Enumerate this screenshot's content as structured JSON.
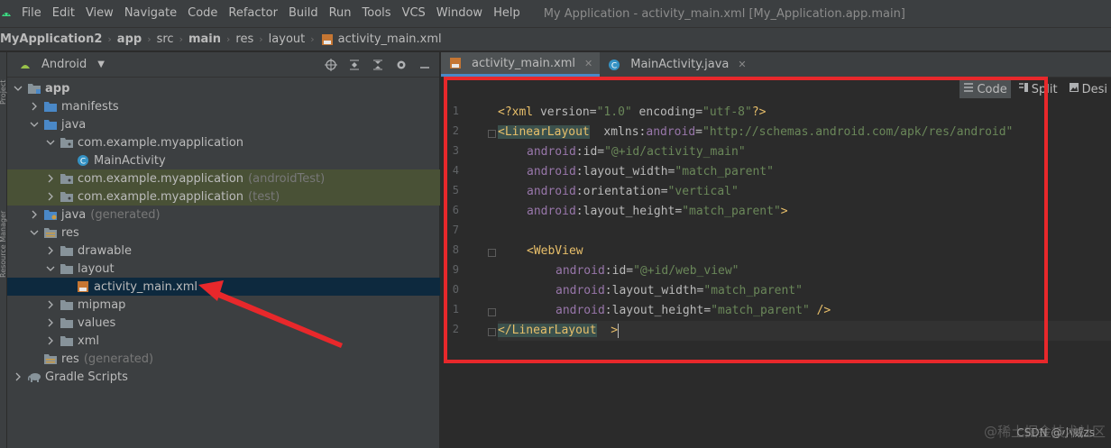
{
  "menubar": {
    "items": [
      "File",
      "Edit",
      "View",
      "Navigate",
      "Code",
      "Refactor",
      "Build",
      "Run",
      "Tools",
      "VCS",
      "Window",
      "Help"
    ],
    "window_title": "My Application - activity_main.xml [My_Application.app.main]"
  },
  "breadcrumb": [
    "MyApplication2",
    "app",
    "src",
    "main",
    "res",
    "layout",
    "activity_main.xml"
  ],
  "left_strip": {
    "top": "Project",
    "bottom": "Resource Manager"
  },
  "project_panel": {
    "view_selector": "Android",
    "tree": [
      {
        "label": "app",
        "suffix": ""
      },
      {
        "label": "manifests",
        "suffix": ""
      },
      {
        "label": "java",
        "suffix": ""
      },
      {
        "label": "com.example.myapplication",
        "suffix": ""
      },
      {
        "label": "MainActivity",
        "suffix": ""
      },
      {
        "label": "com.example.myapplication",
        "suffix": "(androidTest)"
      },
      {
        "label": "com.example.myapplication",
        "suffix": "(test)"
      },
      {
        "label": "java",
        "suffix": "(generated)"
      },
      {
        "label": "res",
        "suffix": ""
      },
      {
        "label": "drawable",
        "suffix": ""
      },
      {
        "label": "layout",
        "suffix": ""
      },
      {
        "label": "activity_main.xml",
        "suffix": ""
      },
      {
        "label": "mipmap",
        "suffix": ""
      },
      {
        "label": "values",
        "suffix": ""
      },
      {
        "label": "xml",
        "suffix": ""
      },
      {
        "label": "res",
        "suffix": "(generated)"
      },
      {
        "label": "Gradle Scripts",
        "suffix": ""
      }
    ]
  },
  "editor": {
    "tabs": [
      {
        "label": "activity_main.xml"
      },
      {
        "label": "MainActivity.java"
      }
    ],
    "modes": [
      "Code",
      "Split",
      "Desi"
    ],
    "line_numbers": [
      "1",
      "2",
      "3",
      "4",
      "5",
      "6",
      "7",
      "8",
      "9",
      "0",
      "1",
      "2"
    ],
    "code": {
      "l1": {
        "a": "<?xml ",
        "b": "version",
        "c": "=",
        "d": "\"1.0\"",
        "e": " encoding",
        "f": "=",
        "g": "\"utf-8\"",
        "h": "?>"
      },
      "l2": {
        "a": "<LinearLayout",
        "b": "  xmlns:",
        "c": "android",
        "d": "=",
        "e": "\"http://schemas.android.com/apk/res/android\""
      },
      "l3": {
        "a": "android",
        "b": ":id",
        "c": "=",
        "d": "\"@+id/activity_main\""
      },
      "l4": {
        "a": "android",
        "b": ":layout_width",
        "c": "=",
        "d": "\"match_parent\""
      },
      "l5": {
        "a": "android",
        "b": ":orientation",
        "c": "=",
        "d": "\"vertical\""
      },
      "l6": {
        "a": "android",
        "b": ":layout_height",
        "c": "=",
        "d": "\"match_parent\"",
        "e": ">"
      },
      "l8": {
        "a": "<WebView"
      },
      "l9": {
        "a": "android",
        "b": ":id",
        "c": "=",
        "d": "\"@+id/web_view\""
      },
      "l10": {
        "a": "android",
        "b": ":layout_width",
        "c": "=",
        "d": "\"match_parent\""
      },
      "l11": {
        "a": "android",
        "b": ":layout_height",
        "c": "=",
        "d": "\"match_parent\"",
        "e": " />"
      },
      "l12": {
        "a": "</LinearLayout",
        "b": "  >"
      }
    }
  },
  "watermark": {
    "back": "@稀土掘金技术社区",
    "front": "CSDN @小威zs"
  },
  "colors": {
    "accent": "#4a88c7",
    "annotation_red": "#e8282b",
    "selection": "#0d293e",
    "highlight": "#495136"
  }
}
